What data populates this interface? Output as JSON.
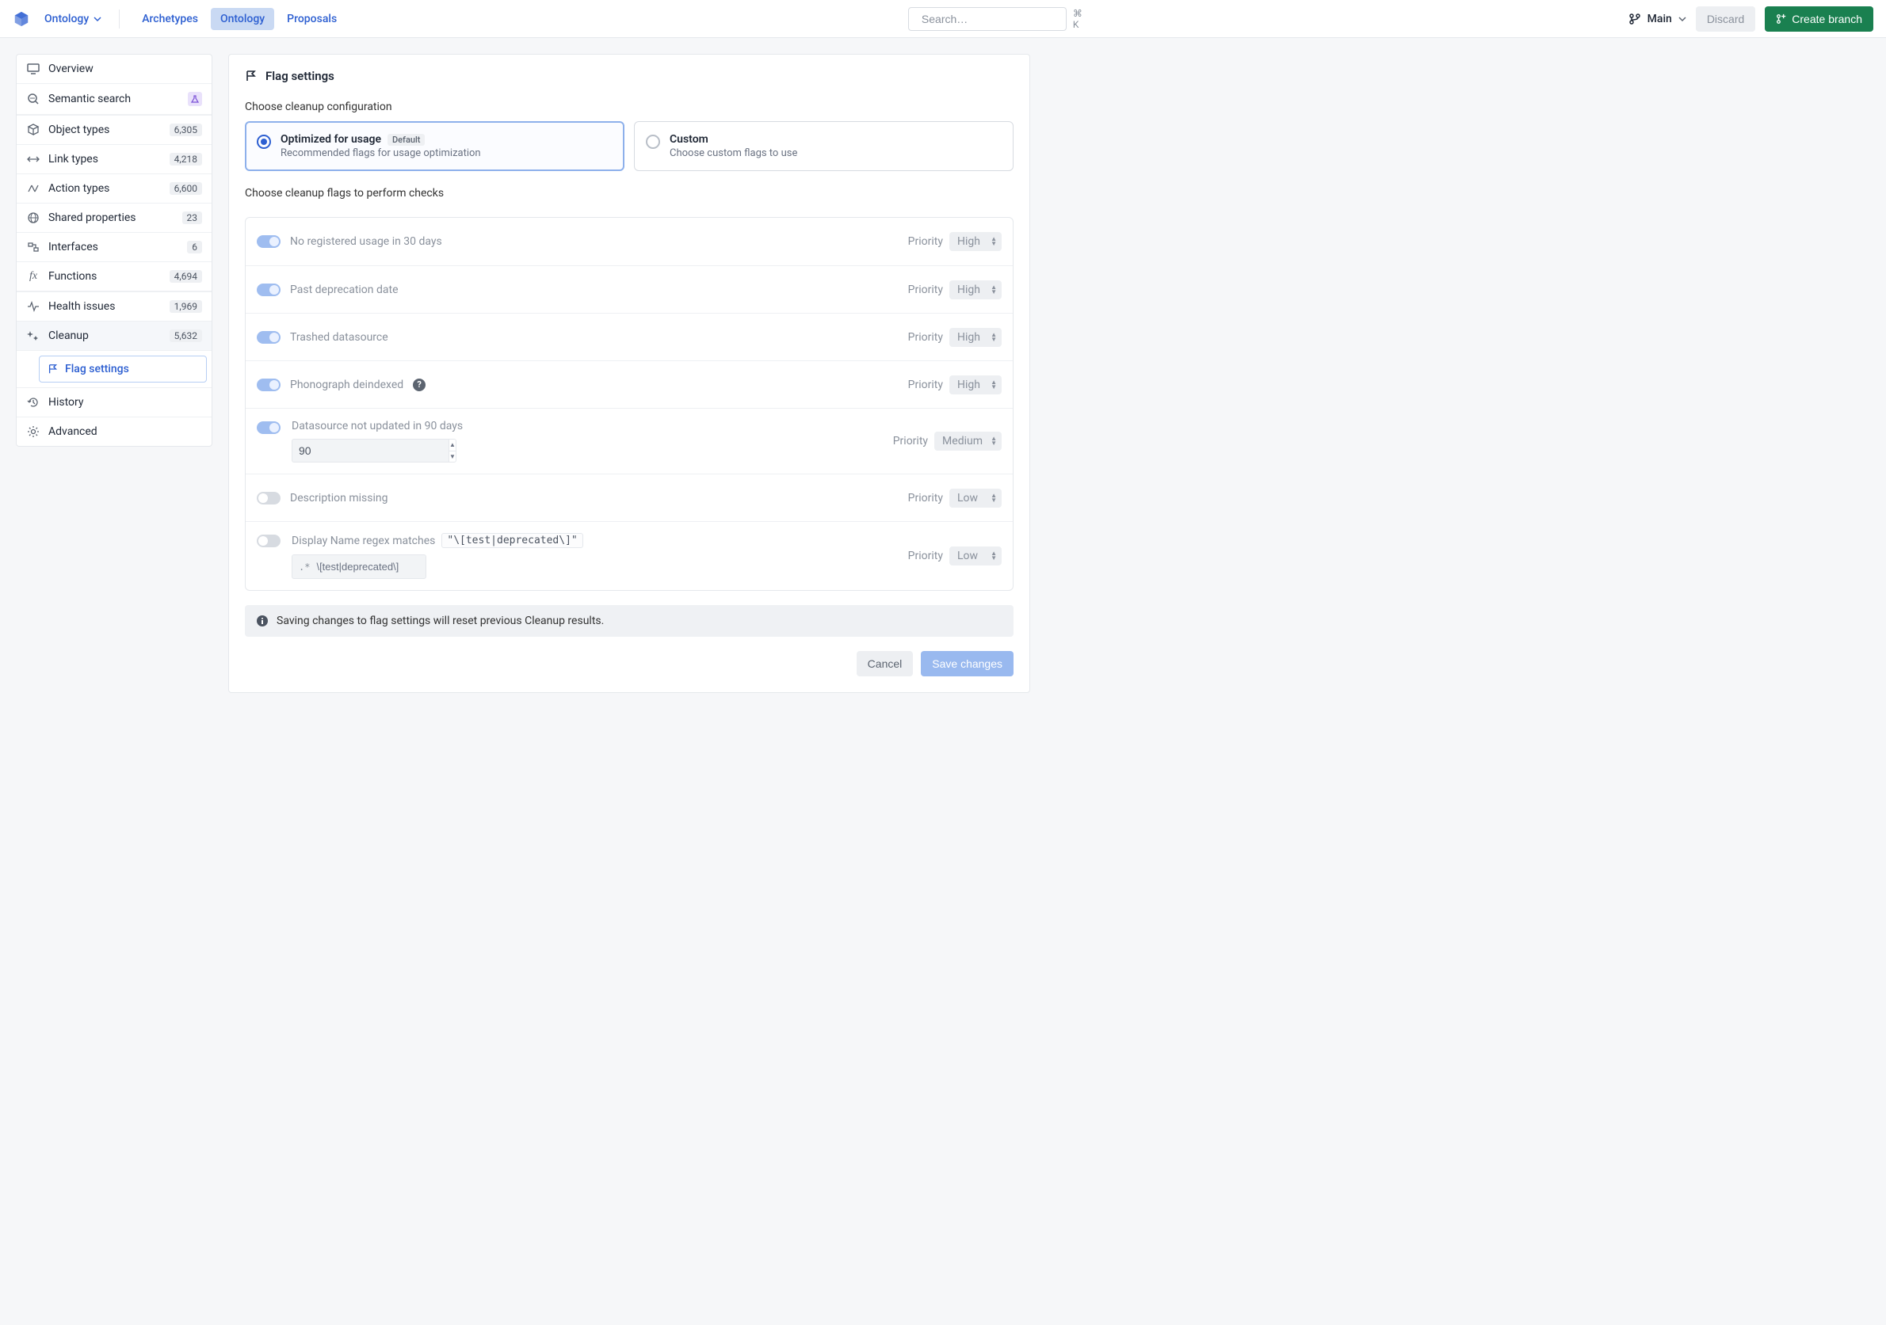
{
  "header": {
    "app_name": "Ontology",
    "tabs": {
      "archetypes": "Archetypes",
      "ontology": "Ontology",
      "proposals": "Proposals"
    },
    "search_placeholder": "Search…",
    "kbd": "⌘ K",
    "branch_label": "Main",
    "discard": "Discard",
    "create_branch": "Create branch"
  },
  "sidebar": {
    "overview": "Overview",
    "semantic_search": "Semantic search",
    "object_types": {
      "label": "Object types",
      "count": "6,305"
    },
    "link_types": {
      "label": "Link types",
      "count": "4,218"
    },
    "action_types": {
      "label": "Action types",
      "count": "6,600"
    },
    "shared_props": {
      "label": "Shared properties",
      "count": "23"
    },
    "interfaces": {
      "label": "Interfaces",
      "count": "6"
    },
    "functions": {
      "label": "Functions",
      "count": "4,694"
    },
    "health": {
      "label": "Health issues",
      "count": "1,969"
    },
    "cleanup": {
      "label": "Cleanup",
      "count": "5,632"
    },
    "flag_settings": "Flag settings",
    "history": "History",
    "advanced": "Advanced"
  },
  "main": {
    "title": "Flag settings",
    "choose_config": "Choose cleanup configuration",
    "opt_title": "Optimized for usage",
    "opt_chip": "Default",
    "opt_sub": "Recommended flags for usage optimization",
    "custom_title": "Custom",
    "custom_sub": "Choose custom flags to use",
    "choose_flags": "Choose cleanup flags to perform checks",
    "priority_label": "Priority",
    "flags": {
      "f1": {
        "name": "No registered usage in 30 days",
        "priority": "High"
      },
      "f2": {
        "name": "Past deprecation date",
        "priority": "High"
      },
      "f3": {
        "name": "Trashed datasource",
        "priority": "High"
      },
      "f4": {
        "name": "Phonograph deindexed",
        "priority": "High"
      },
      "f5": {
        "name": "Datasource not updated in 90 days",
        "value": "90",
        "priority": "Medium"
      },
      "f6": {
        "name": "Description missing",
        "priority": "Low"
      },
      "f7": {
        "name": "Display Name regex matches",
        "code": "\"\\[test|deprecated\\]\"",
        "input": "\\[test|deprecated\\]",
        "priority": "Low"
      }
    },
    "banner": "Saving changes to flag settings will reset previous Cleanup results.",
    "cancel": "Cancel",
    "save": "Save changes"
  }
}
